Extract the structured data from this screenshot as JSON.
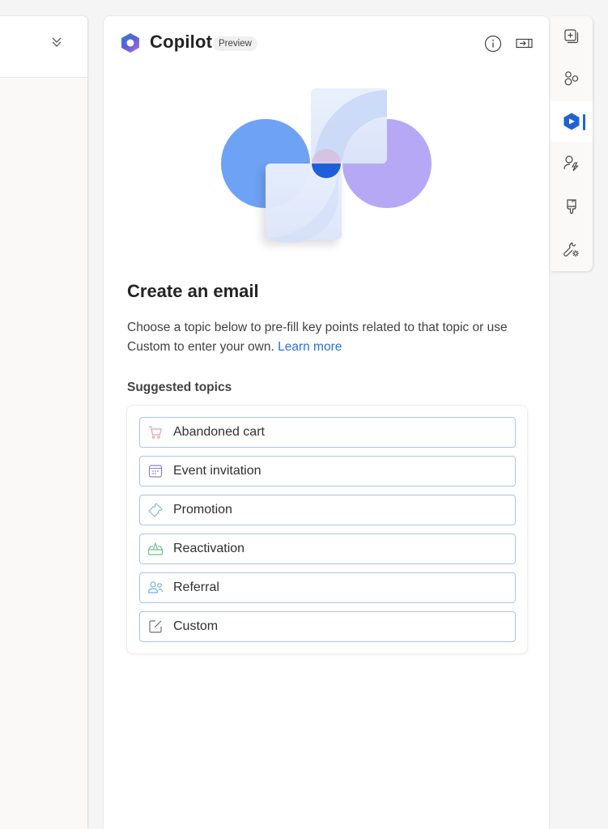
{
  "left_panel": {
    "collapse_icon": "chevron-double-down-icon"
  },
  "copilot": {
    "logo_icon": "copilot-logo-icon",
    "title": "Copilot",
    "badge": "Preview",
    "info_icon": "info-icon",
    "dock_icon": "dock-panel-icon",
    "heading": "Create an email",
    "description": "Choose a topic below to pre-fill key points related to that topic or use Custom to enter your own.",
    "learn_more": "Learn more",
    "section_label": "Suggested topics",
    "topics": [
      {
        "label": "Abandoned cart",
        "icon": "cart-icon",
        "color": "#e8a0a8"
      },
      {
        "label": "Event invitation",
        "icon": "calendar-icon",
        "color": "#8a84c8"
      },
      {
        "label": "Promotion",
        "icon": "ticket-icon",
        "color": "#8fb3e8"
      },
      {
        "label": "Reactivation",
        "icon": "inbox-arrow-icon",
        "color": "#6fc08d"
      },
      {
        "label": "Referral",
        "icon": "people-icon",
        "color": "#6ab7d9"
      },
      {
        "label": "Custom",
        "icon": "edit-icon",
        "color": "#707070"
      }
    ]
  },
  "rail": {
    "items": [
      {
        "name": "add-content",
        "icon": "add-square-icon"
      },
      {
        "name": "elements",
        "icon": "shapes-icon"
      },
      {
        "name": "copilot",
        "icon": "copilot-icon",
        "active": true
      },
      {
        "name": "personalization",
        "icon": "person-lightning-icon"
      },
      {
        "name": "styles",
        "icon": "paintbrush-icon"
      },
      {
        "name": "settings",
        "icon": "wrench-settings-icon"
      }
    ],
    "accent": "#1f63d2"
  }
}
